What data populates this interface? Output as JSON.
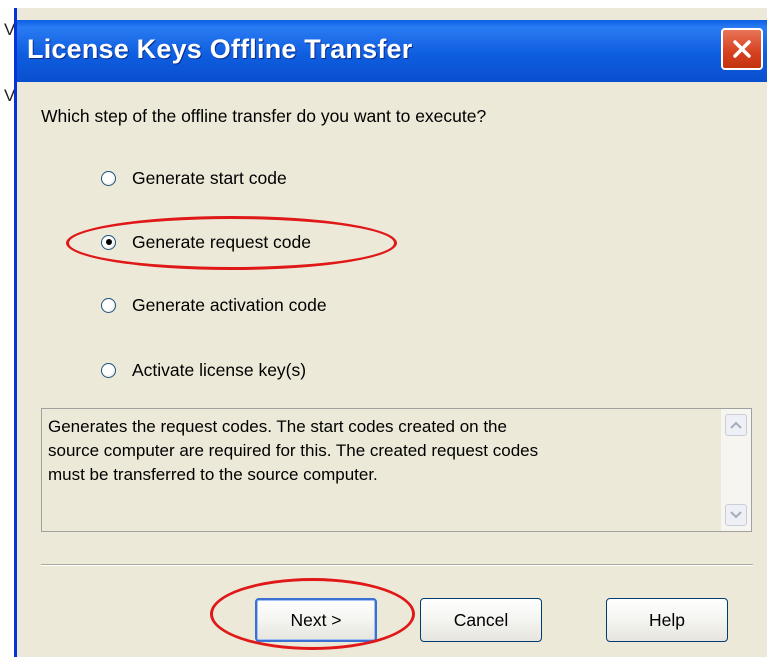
{
  "window": {
    "title": "License Keys Offline Transfer"
  },
  "background": {
    "fragments": [
      "V",
      "V"
    ]
  },
  "prompt": "Which step of the offline transfer do you want to execute?",
  "options": [
    {
      "label": "Generate start code",
      "selected": false
    },
    {
      "label": "Generate request code",
      "selected": true
    },
    {
      "label": "Generate activation code",
      "selected": false
    },
    {
      "label": "Activate license key(s)",
      "selected": false
    }
  ],
  "description": "Generates the request codes. The start codes created on the\nsource computer are  required for this. The created request codes\nmust be transferred to the source computer.",
  "buttons": {
    "next": "Next >",
    "cancel": "Cancel",
    "help": "Help"
  },
  "colors": {
    "titlebar": "#0a5fe4",
    "close_button": "#d6401f",
    "dialog_bg": "#ece9d8",
    "highlight_ellipse": "#e01818"
  },
  "icons": {
    "close": "close-icon",
    "scroll_up": "scroll-up-icon",
    "scroll_down": "scroll-down-icon"
  }
}
